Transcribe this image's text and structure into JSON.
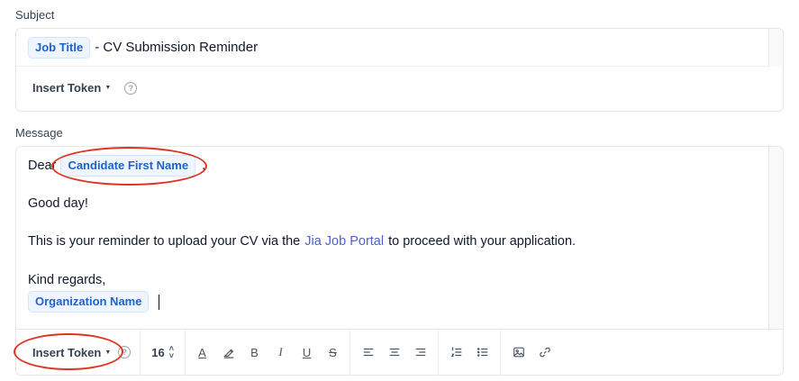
{
  "subject": {
    "label": "Subject",
    "token": "Job Title",
    "text": "- CV Submission Reminder",
    "insert_token_label": "Insert Token",
    "help_symbol": "?"
  },
  "message": {
    "label": "Message",
    "greeting_prefix": "Dear",
    "candidate_token": "Candidate First Name",
    "greeting_suffix": ",",
    "line_good_day": "Good day!",
    "reminder_before": "This is your reminder to upload your CV via the",
    "reminder_link": "Jia Job Portal",
    "reminder_after": "to proceed with your application.",
    "closing": "Kind regards,",
    "org_token": "Organization Name"
  },
  "toolbar": {
    "insert_token_label": "Insert Token",
    "help_symbol": "?",
    "font_size": "16",
    "bold_glyph": "B",
    "italic_glyph": "I",
    "underline_glyph": "U",
    "strike_glyph": "S",
    "text_color_glyph": "A"
  },
  "colors": {
    "token_bg": "#eef5ff",
    "token_text": "#1d63c9",
    "link": "#4f5fd6",
    "annotation": "#e0331f"
  }
}
